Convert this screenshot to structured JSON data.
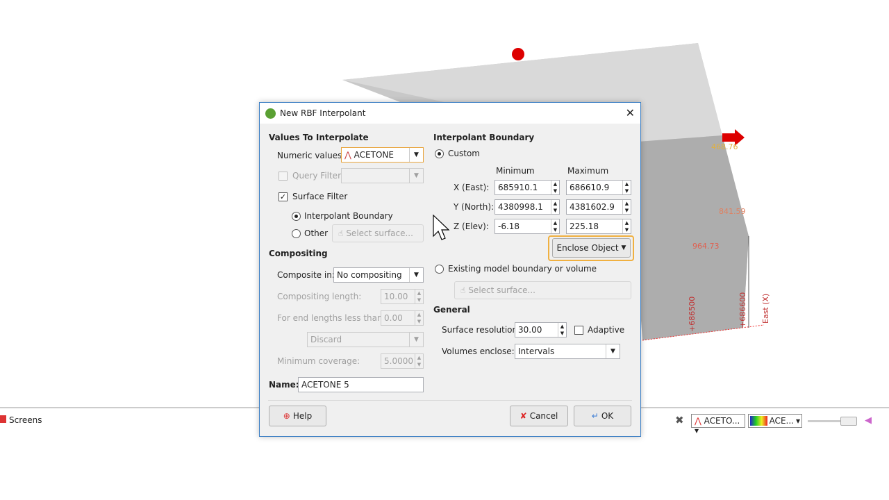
{
  "scene": {
    "labels": [
      "468.76",
      "841.59",
      "964.73",
      "+686500",
      "+686600",
      "East (X)"
    ]
  },
  "dialog": {
    "title": "New RBF Interpolant",
    "values_section": "Values To Interpolate",
    "numeric_label": "Numeric values:",
    "numeric_value": "ACETONE",
    "query_filter_label": "Query Filter",
    "query_filter_checked": false,
    "surface_filter_label": "Surface Filter",
    "surface_filter_checked": true,
    "interpolant_boundary_label": "Interpolant Boundary",
    "other_label": "Other",
    "select_surface": "Select surface...",
    "compositing_section": "Compositing",
    "composite_in_label": "Composite in:",
    "composite_in_value": "No compositing",
    "compositing_length_label": "Compositing length:",
    "compositing_length_value": "10.00",
    "end_lengths_label": "For end lengths less than:",
    "end_lengths_value": "0.00",
    "discard_value": "Discard",
    "min_coverage_label": "Minimum coverage:",
    "min_coverage_value": "5.0000",
    "name_label": "Name:",
    "name_value": "ACETONE 5",
    "boundary_section": "Interpolant Boundary",
    "custom_label": "Custom",
    "min_header": "Minimum",
    "max_header": "Maximum",
    "x_label": "X (East):",
    "x_min": "685910.1",
    "x_max": "686610.9",
    "y_label": "Y (North):",
    "y_min": "4380998.1",
    "y_max": "4381602.9",
    "z_label": "Z (Elev):",
    "z_min": "-6.18",
    "z_max": "225.18",
    "enclose_object": "Enclose Object",
    "existing_label": "Existing model boundary or volume",
    "existing_select": "Select surface...",
    "general_section": "General",
    "surface_resolution_label": "Surface resolution:",
    "surface_resolution_value": "30.00",
    "adaptive_label": "Adaptive",
    "adaptive_checked": false,
    "volumes_enclose_label": "Volumes enclose:",
    "volumes_enclose_value": "Intervals",
    "help": "Help",
    "cancel": "Cancel",
    "ok": "OK"
  },
  "bottom": {
    "screens": "Screens",
    "attr1": "ACETO...",
    "attr2": "ACE..."
  }
}
